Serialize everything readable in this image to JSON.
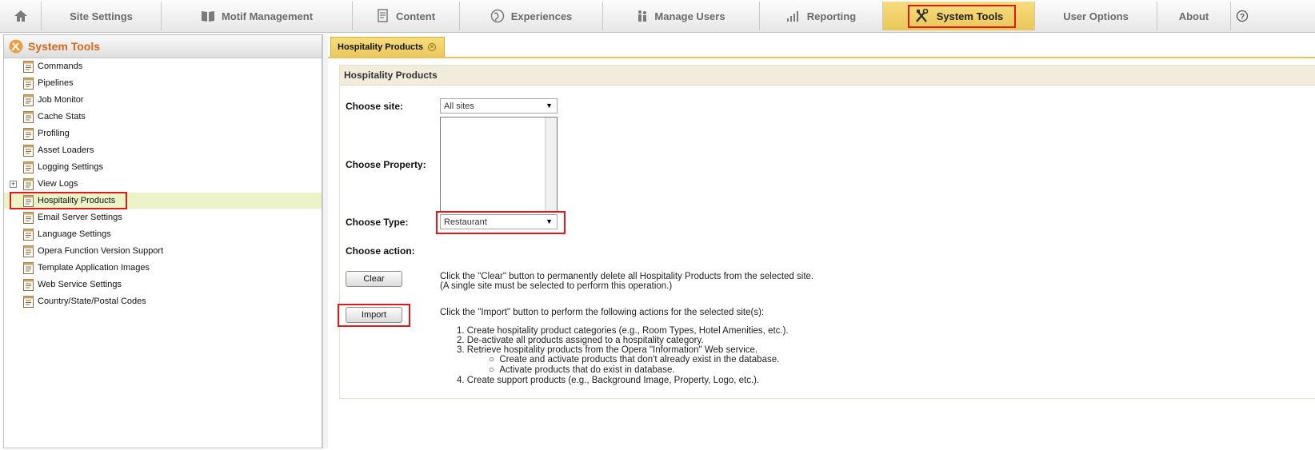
{
  "topnav": {
    "items": [
      {
        "label": "",
        "icon": "home-icon"
      },
      {
        "label": "Site Settings",
        "icon": ""
      },
      {
        "label": "Motif Management",
        "icon": "book-icon"
      },
      {
        "label": "Content",
        "icon": "document-icon"
      },
      {
        "label": "Experiences",
        "icon": "globe-icon"
      },
      {
        "label": "Manage Users",
        "icon": "users-icon"
      },
      {
        "label": "Reporting",
        "icon": "bar-chart-icon"
      },
      {
        "label": "System Tools",
        "icon": "tools-icon"
      },
      {
        "label": "User Options",
        "icon": ""
      },
      {
        "label": "About",
        "icon": ""
      },
      {
        "label": "",
        "icon": "help-icon"
      }
    ],
    "active": "System Tools"
  },
  "sidebar": {
    "title": "System Tools",
    "items": [
      {
        "label": "Commands"
      },
      {
        "label": "Pipelines"
      },
      {
        "label": "Job Monitor"
      },
      {
        "label": "Cache Stats"
      },
      {
        "label": "Profiling"
      },
      {
        "label": "Asset Loaders"
      },
      {
        "label": "Logging Settings"
      },
      {
        "label": "View Logs"
      },
      {
        "label": "Hospitality Products"
      },
      {
        "label": "Email Server Settings"
      },
      {
        "label": "Language Settings"
      },
      {
        "label": "Opera Function Version Support"
      },
      {
        "label": "Template Application Images"
      },
      {
        "label": "Web Service Settings"
      },
      {
        "label": "Country/State/Postal Codes"
      }
    ],
    "selected": "Hospitality Products"
  },
  "tab": {
    "label": "Hospitality Products"
  },
  "form": {
    "header": "Hospitality Products",
    "site_label": "Choose site:",
    "site_value": "All sites",
    "property_label": "Choose Property:",
    "type_label": "Choose Type:",
    "type_value": "Restaurant",
    "action_label": "Choose action:",
    "clear_button": "Clear",
    "clear_desc_1": "Click the \"Clear\" button to permanently delete all Hospitality Products from the selected site.",
    "clear_desc_2": "(A single site must be selected to perform this operation.)",
    "import_button": "Import",
    "import_desc": "Click the \"Import\" button to perform the following actions for the selected site(s):",
    "steps": [
      "1.  Create hospitality product categories (e.g., Room Types, Hotel Amenities, etc.).",
      "2.  De-activate all products assigned to a hospitality category.",
      "3.  Retrieve hospitality products from the Opera \"Information\" Web service.",
      "4.  Create support products (e.g., Background Image, Property, Logo, etc.)."
    ],
    "substeps": [
      "Create and activate products that don't already exist in the database.",
      "Activate products that do exist in database."
    ]
  },
  "colors": {
    "accent": "#f0d06a",
    "highlight": "#e0191c",
    "sidebar_title": "#d2691e"
  }
}
